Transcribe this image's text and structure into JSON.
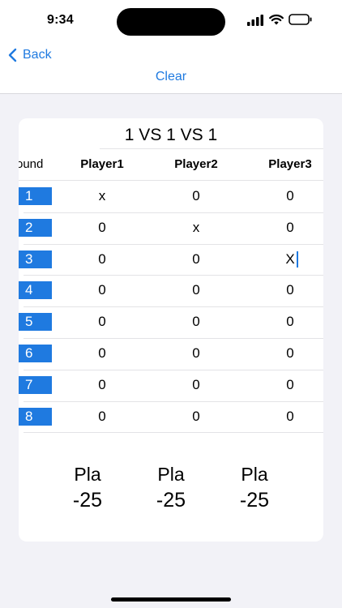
{
  "status_bar": {
    "time": "9:34"
  },
  "nav": {
    "back_label": "Back",
    "clear_label": "Clear",
    "accent_color": "#1f7ae0"
  },
  "game": {
    "title": "1 VS 1 VS 1",
    "round_header": "ound",
    "players": [
      {
        "name": "Player1"
      },
      {
        "name": "Player2"
      },
      {
        "name": "Player3"
      }
    ],
    "rounds": [
      {
        "label": "1",
        "scores": [
          "x",
          "0",
          "0"
        ]
      },
      {
        "label": "2",
        "scores": [
          "0",
          "x",
          "0"
        ]
      },
      {
        "label": "3",
        "scores": [
          "0",
          "0",
          "X"
        ]
      },
      {
        "label": "4",
        "scores": [
          "0",
          "0",
          "0"
        ]
      },
      {
        "label": "5",
        "scores": [
          "0",
          "0",
          "0"
        ]
      },
      {
        "label": "6",
        "scores": [
          "0",
          "0",
          "0"
        ]
      },
      {
        "label": "7",
        "scores": [
          "0",
          "0",
          "0"
        ]
      },
      {
        "label": "8",
        "scores": [
          "0",
          "0",
          "0"
        ]
      }
    ],
    "totals": [
      {
        "name": "Pla",
        "score": "-25"
      },
      {
        "name": "Pla",
        "score": "-25"
      },
      {
        "name": "Pla",
        "score": "-25"
      }
    ]
  }
}
